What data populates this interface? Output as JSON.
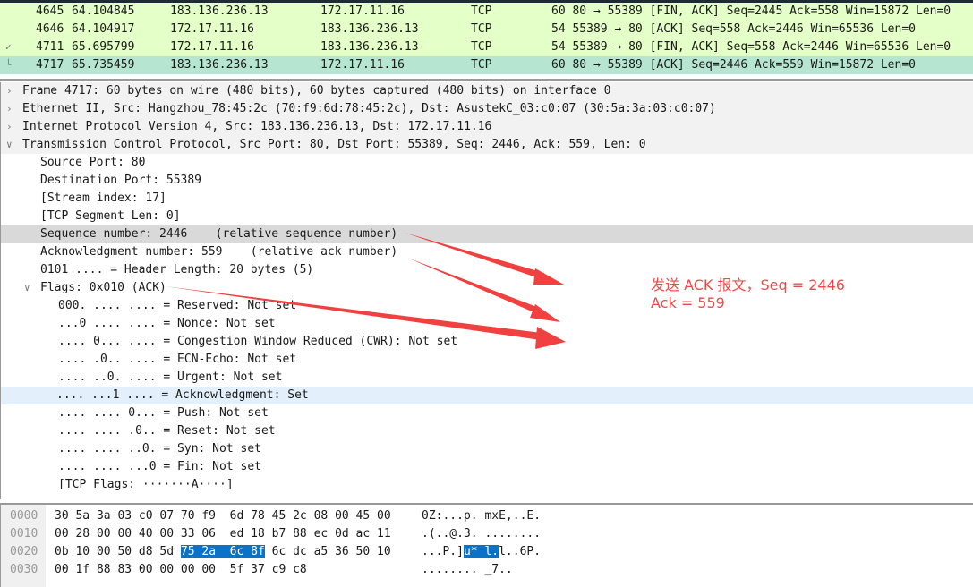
{
  "packets": [
    {
      "no": "4645",
      "time": "64.104845",
      "src": "183.136.236.13",
      "dst": "172.17.11.16",
      "proto": "TCP",
      "info": "60 80 → 55389 [FIN, ACK] Seq=2445 Ack=558 Win=15872 Len=0"
    },
    {
      "no": "4646",
      "time": "64.104917",
      "src": "172.17.11.16",
      "dst": "183.136.236.13",
      "proto": "TCP",
      "info": "54 55389 → 80 [ACK] Seq=558 Ack=2446 Win=65536 Len=0"
    },
    {
      "no": "4711",
      "time": "65.695799",
      "src": "172.17.11.16",
      "dst": "183.136.236.13",
      "proto": "TCP",
      "info": "54 55389 → 80 [FIN, ACK] Seq=558 Ack=2446 Win=65536 Len=0"
    },
    {
      "no": "4717",
      "time": "65.735459",
      "src": "183.136.236.13",
      "dst": "172.17.11.16",
      "proto": "TCP",
      "info": "60 80 → 55389 [ACK] Seq=2446 Ack=559 Win=15872 Len=0"
    }
  ],
  "tree": [
    "Frame 4717: 60 bytes on wire (480 bits), 60 bytes captured (480 bits) on interface 0",
    "Ethernet II, Src: Hangzhou_78:45:2c (70:f9:6d:78:45:2c), Dst: AsustekC_03:c0:07 (30:5a:3a:03:c0:07)",
    "Internet Protocol Version 4, Src: 183.136.236.13, Dst: 172.17.11.16",
    "Transmission Control Protocol, Src Port: 80, Dst Port: 55389, Seq: 2446, Ack: 559, Len: 0",
    "Source Port: 80",
    "Destination Port: 55389",
    "[Stream index: 17]",
    "[TCP Segment Len: 0]",
    "Sequence number: 2446    (relative sequence number)",
    "Acknowledgment number: 559    (relative ack number)",
    "0101 .... = Header Length: 20 bytes (5)",
    "Flags: 0x010 (ACK)",
    "000. .... .... = Reserved: Not set",
    "...0 .... .... = Nonce: Not set",
    ".... 0... .... = Congestion Window Reduced (CWR): Not set",
    ".... .0.. .... = ECN-Echo: Not set",
    ".... ..0. .... = Urgent: Not set",
    ".... ...1 .... = Acknowledgment: Set",
    ".... .... 0... = Push: Not set",
    ".... .... .0.. = Reset: Not set",
    ".... .... ..0. = Syn: Not set",
    ".... .... ...0 = Fin: Not set",
    "[TCP Flags: ·······A····]"
  ],
  "hex": [
    {
      "off": "0000",
      "a": "30 5a 3a 03 c0 07 70 f9  6d 78 45 2c 08 00 45 00",
      "asc": "0Z:...p. mxE,..E."
    },
    {
      "off": "0010",
      "a": "00 28 00 00 40 00 33 06  ed 18 b7 88 ec 0d ac 11",
      "asc": ".(..@.3. ........"
    },
    {
      "off": "0020",
      "a1": "0b 10 00 50 d8 5d ",
      "m": "75 2a  6c 8f",
      "a2": " 6c dc a5 36 50 10",
      "asc1": "...P.]",
      "masc": "u* l.",
      "asc2": "l..6P."
    },
    {
      "off": "0030",
      "a": "00 1f 88 83 00 00 00 00  5f 37 c9 c8",
      "asc": "........ _7.."
    }
  ],
  "annotation": {
    "line1": "发送 ACK 报文，Seq = 2446",
    "line2": "Ack = 559",
    "color": "#f04848"
  }
}
